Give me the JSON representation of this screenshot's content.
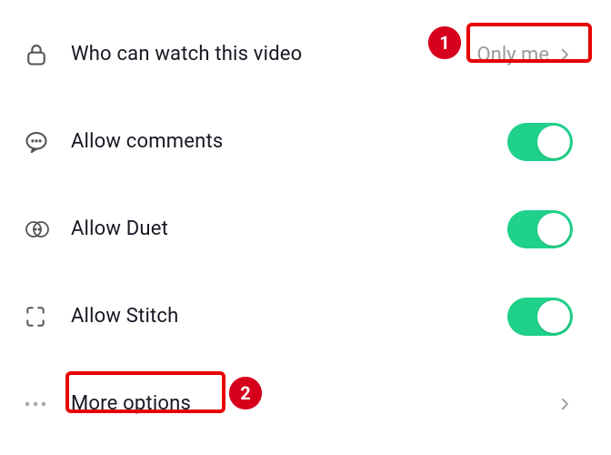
{
  "settings": {
    "visibility": {
      "label": "Who can watch this video",
      "value": "Only me"
    },
    "comments": {
      "label": "Allow comments",
      "enabled": true
    },
    "duet": {
      "label": "Allow Duet",
      "enabled": true
    },
    "stitch": {
      "label": "Allow Stitch",
      "enabled": true
    },
    "more": {
      "label": "More options"
    }
  },
  "annotations": {
    "first": "1",
    "second": "2"
  }
}
